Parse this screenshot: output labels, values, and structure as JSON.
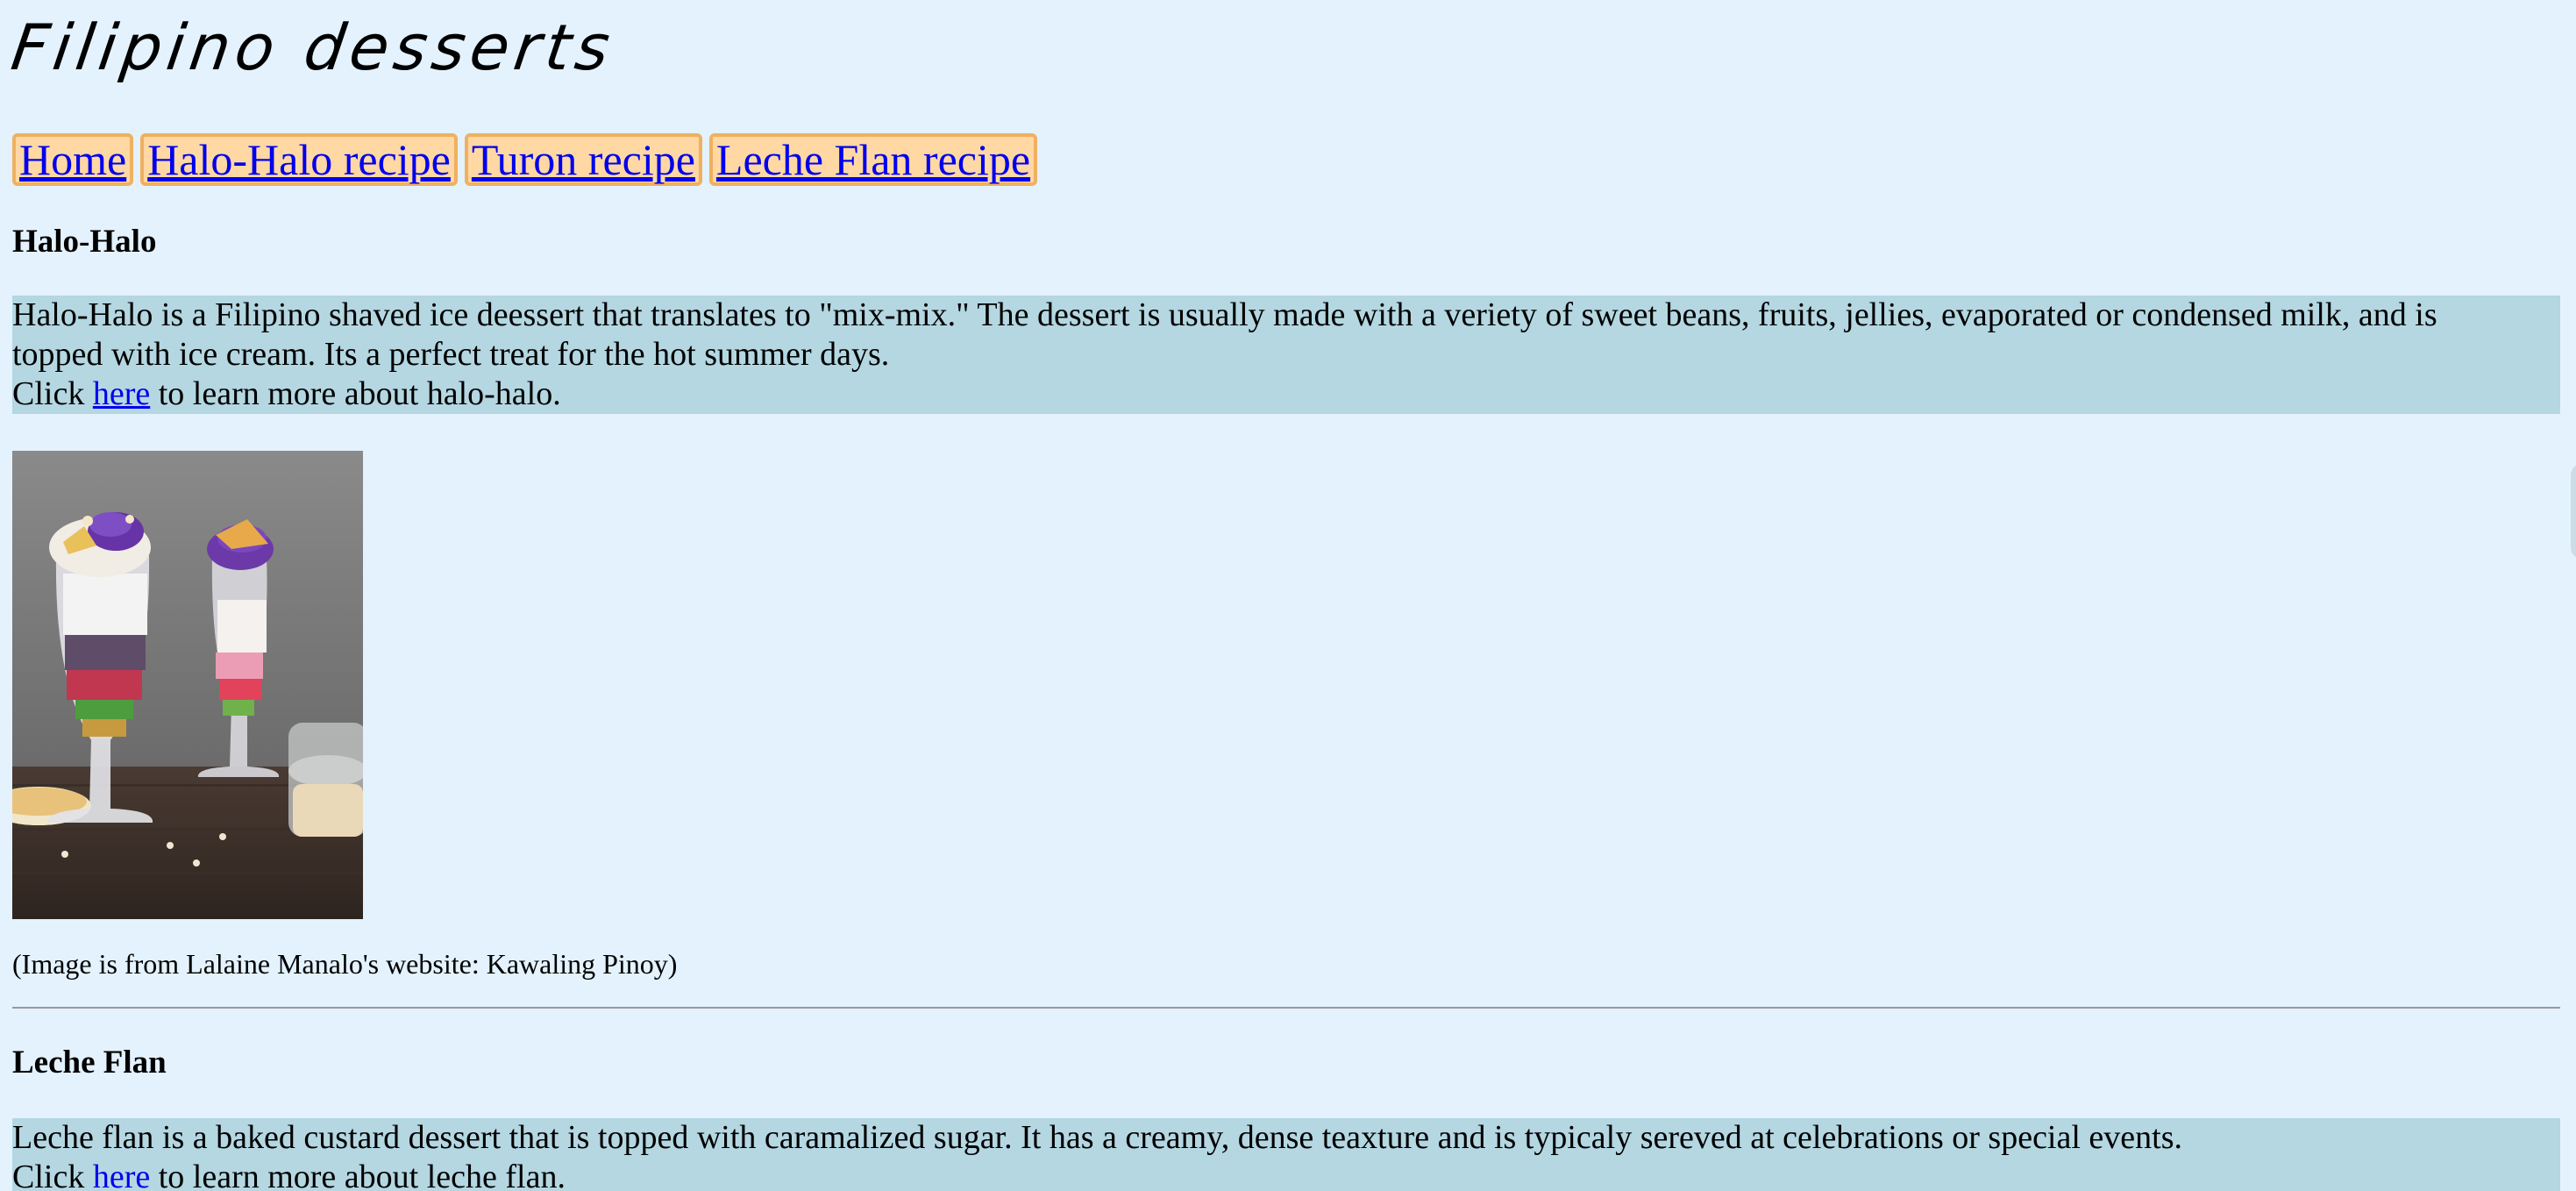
{
  "header": {
    "title": "Filipino desserts"
  },
  "nav": {
    "items": [
      {
        "label": "Home"
      },
      {
        "label": "Halo-Halo recipe"
      },
      {
        "label": "Turon recipe"
      },
      {
        "label": "Leche Flan recipe"
      }
    ]
  },
  "halo_halo": {
    "heading": "Halo-Halo",
    "description": "Halo-Halo is a Filipino shaved ice deessert that translates to \"mix-mix.\" The dessert is usually made with a veriety of sweet beans, fruits, jellies, evaporated or condensed milk, and is topped with ice cream. Its a perfect treat for the hot summer days.",
    "click_prefix": "Click ",
    "link_text": "here",
    "click_suffix": " to learn more about halo-halo.",
    "image_caption": "(Image is from Lalaine Manalo's website: Kawaling Pinoy)"
  },
  "leche_flan": {
    "heading": "Leche Flan",
    "description": "Leche flan is a baked custard dessert that is topped with caramalized sugar. It has a creamy, dense teaxture and is typicaly sereved at celebrations or special events.",
    "click_prefix": "Click ",
    "link_text": "here",
    "click_suffix": " to learn more about leche flan."
  },
  "colors": {
    "background": "#e3f2fd",
    "nav_button_bg": "#ffd8a3",
    "nav_button_border": "#f0b060",
    "description_bg": "#b4d7e2",
    "link": "#0000ee"
  }
}
